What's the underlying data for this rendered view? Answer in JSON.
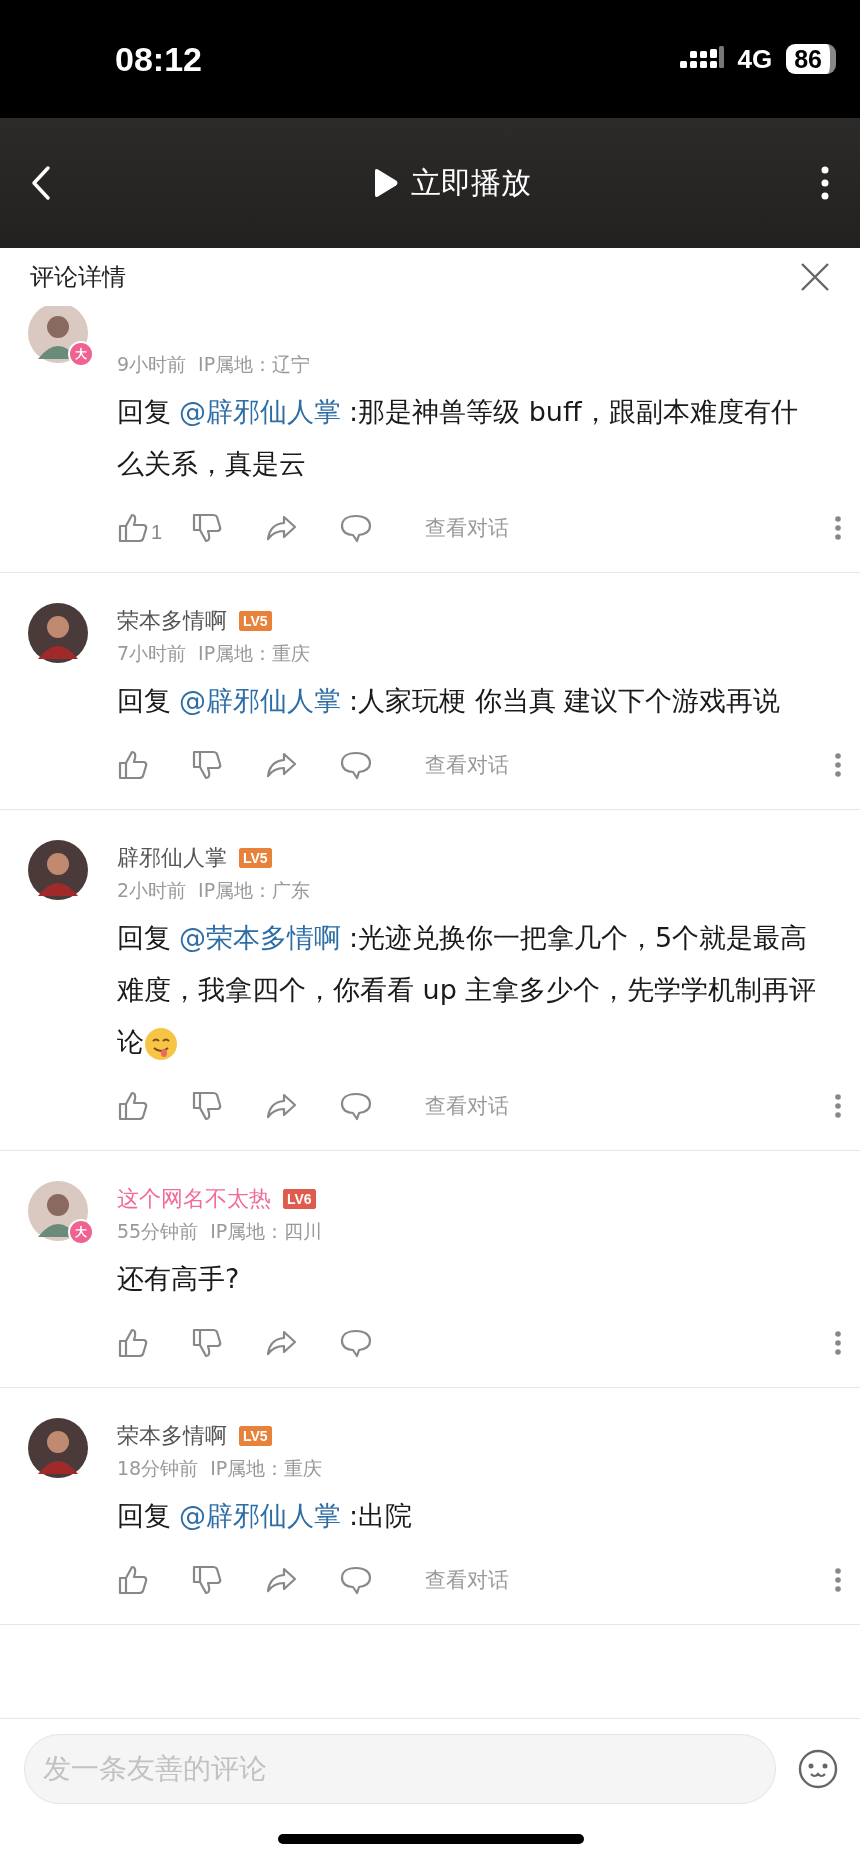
{
  "status_bar": {
    "time": "08:12",
    "network": "4G",
    "battery": "86"
  },
  "nav_bar": {
    "title": "立即播放"
  },
  "panel": {
    "title": "评论详情"
  },
  "comments": [
    {
      "vip": true,
      "avatar_badge": "大",
      "time": "9小时前",
      "ip": "IP属地：辽宁",
      "reply_prefix": "回复",
      "mention": "@辟邪仙人掌",
      "text": ":那是神兽等级 buff，跟副本难度有什么关系，真是云",
      "emoji": false,
      "likes": "1",
      "view_dialog": "查看对话"
    },
    {
      "name": "荣本多情啊",
      "level": "LV5",
      "color": "#e8823a",
      "vip": false,
      "time": "7小时前",
      "ip": "IP属地：重庆",
      "reply_prefix": "回复",
      "mention": "@辟邪仙人掌",
      "text": ":人家玩梗 你当真 建议下个游戏再说",
      "emoji": false,
      "view_dialog": "查看对话"
    },
    {
      "name": "辟邪仙人掌",
      "level": "LV5",
      "color": "#e8823a",
      "vip": false,
      "time": "2小时前",
      "ip": "IP属地：广东",
      "reply_prefix": "回复",
      "mention": "@荣本多情啊",
      "text": ":光迹兑换你一把拿几个，5个就是最高难度，我拿四个，你看看 up 主拿多少个，先学学机制再评论",
      "emoji": true,
      "view_dialog": "查看对话"
    },
    {
      "name": "这个网名不太热",
      "level": "LV6",
      "color": "#e05a4e",
      "vip": true,
      "avatar_badge": "大",
      "time": "55分钟前",
      "ip": "IP属地：四川",
      "text": "还有高手?",
      "emoji": false
    },
    {
      "name": "荣本多情啊",
      "level": "LV5",
      "color": "#e8823a",
      "vip": false,
      "time": "18分钟前",
      "ip": "IP属地：重庆",
      "reply_prefix": "回复",
      "mention": "@辟邪仙人掌",
      "text": ":出院",
      "emoji": false,
      "view_dialog": "查看对话"
    }
  ],
  "composer": {
    "placeholder": "发一条友善的评论"
  }
}
